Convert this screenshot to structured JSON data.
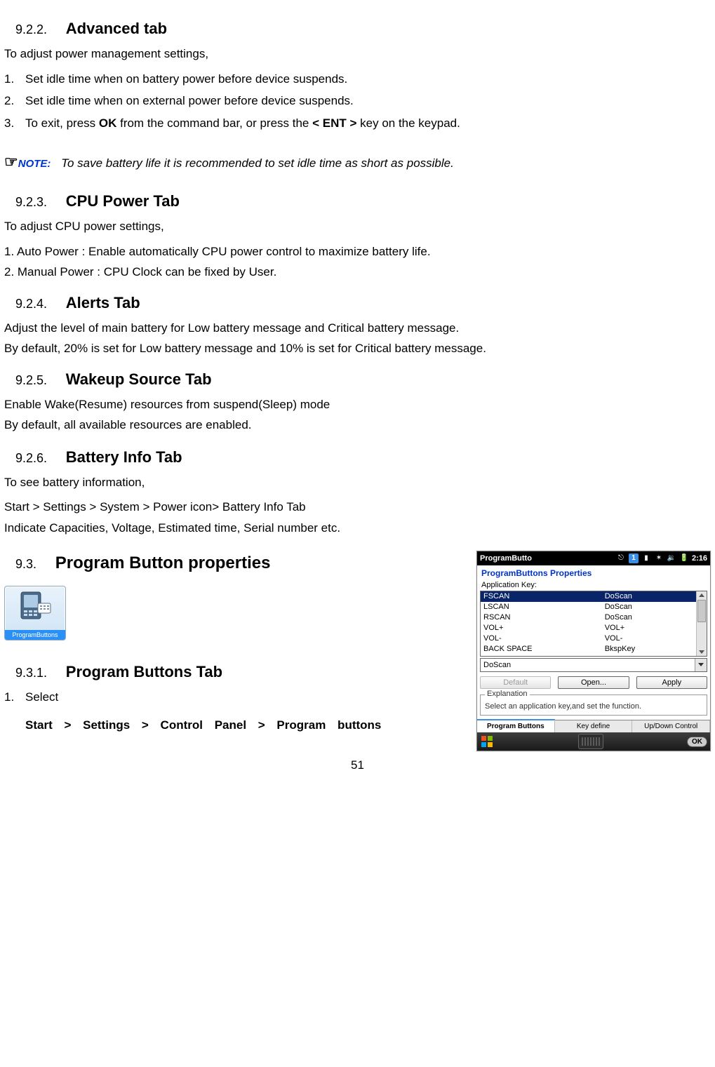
{
  "s922": {
    "num": "9.2.2.",
    "title": "Advanced tab",
    "p1": "To adjust power management settings,",
    "li1": "Set idle time when on battery power before device suspends.",
    "li2": "Set idle time when on external power before device suspends.",
    "li3_pre": "To exit, press ",
    "li3_b1": "OK",
    "li3_mid": " from the command bar, or press the ",
    "li3_b2": "< ENT >",
    "li3_post": " key on the keypad."
  },
  "note": {
    "point": "☞",
    "label": "NOTE:",
    "text": "To save battery life it is recommended to set idle time as short as possible."
  },
  "s923": {
    "num": "9.2.3.",
    "title": "CPU Power Tab",
    "p1": "To adjust CPU power settings,",
    "p2": "1. Auto Power : Enable automatically CPU power control to maximize battery life.",
    "p3": "2. Manual Power : CPU Clock can be fixed by User."
  },
  "s924": {
    "num": "9.2.4.",
    "title": "Alerts Tab",
    "p1": "Adjust the level of main battery for Low battery message and Critical battery message.",
    "p2": "By default, 20% is set for Low battery message and 10% is set for Critical battery message."
  },
  "s925": {
    "num": "9.2.5.",
    "title": "Wakeup Source Tab",
    "p1": "Enable Wake(Resume) resources from suspend(Sleep) mode",
    "p2": "By default, all available resources are enabled."
  },
  "s926": {
    "num": "9.2.6.",
    "title": "Battery Info Tab",
    "p1": "To see battery information,",
    "p2": "Start > Settings > System > Power icon> Battery Info Tab",
    "p3": "Indicate Capacities, Voltage, Estimated time, Serial number etc."
  },
  "s93": {
    "num": "9.3.",
    "title": "Program Button properties",
    "icon_caption": "ProgramButtons"
  },
  "s931": {
    "num": "9.3.1.",
    "title": "Program Buttons Tab",
    "li1": "Select",
    "li1b_pre": "Start > Settings > Control Panel > Program buttons"
  },
  "shot": {
    "titlebar": "ProgramButto",
    "tray_num": "1",
    "time": "2:16",
    "prop_title": "ProgramButtons Properties",
    "app_key_label": "Application Key:",
    "rows": [
      {
        "k": "FSCAN",
        "v": "DoScan"
      },
      {
        "k": "LSCAN",
        "v": "DoScan"
      },
      {
        "k": "RSCAN",
        "v": "DoScan"
      },
      {
        "k": "VOL+",
        "v": "VOL+"
      },
      {
        "k": "VOL-",
        "v": "VOL-"
      },
      {
        "k": "BACK SPACE",
        "v": "BkspKey"
      }
    ],
    "combo": "DoScan",
    "btn_default": "Default",
    "btn_open": "Open...",
    "btn_apply": "Apply",
    "group_label": "Explanation",
    "group_text": "Select an application key,and set the function.",
    "tab1": "Program Buttons",
    "tab2": "Key define",
    "tab3": "Up/Down Control",
    "ok": "OK"
  },
  "page": "51"
}
